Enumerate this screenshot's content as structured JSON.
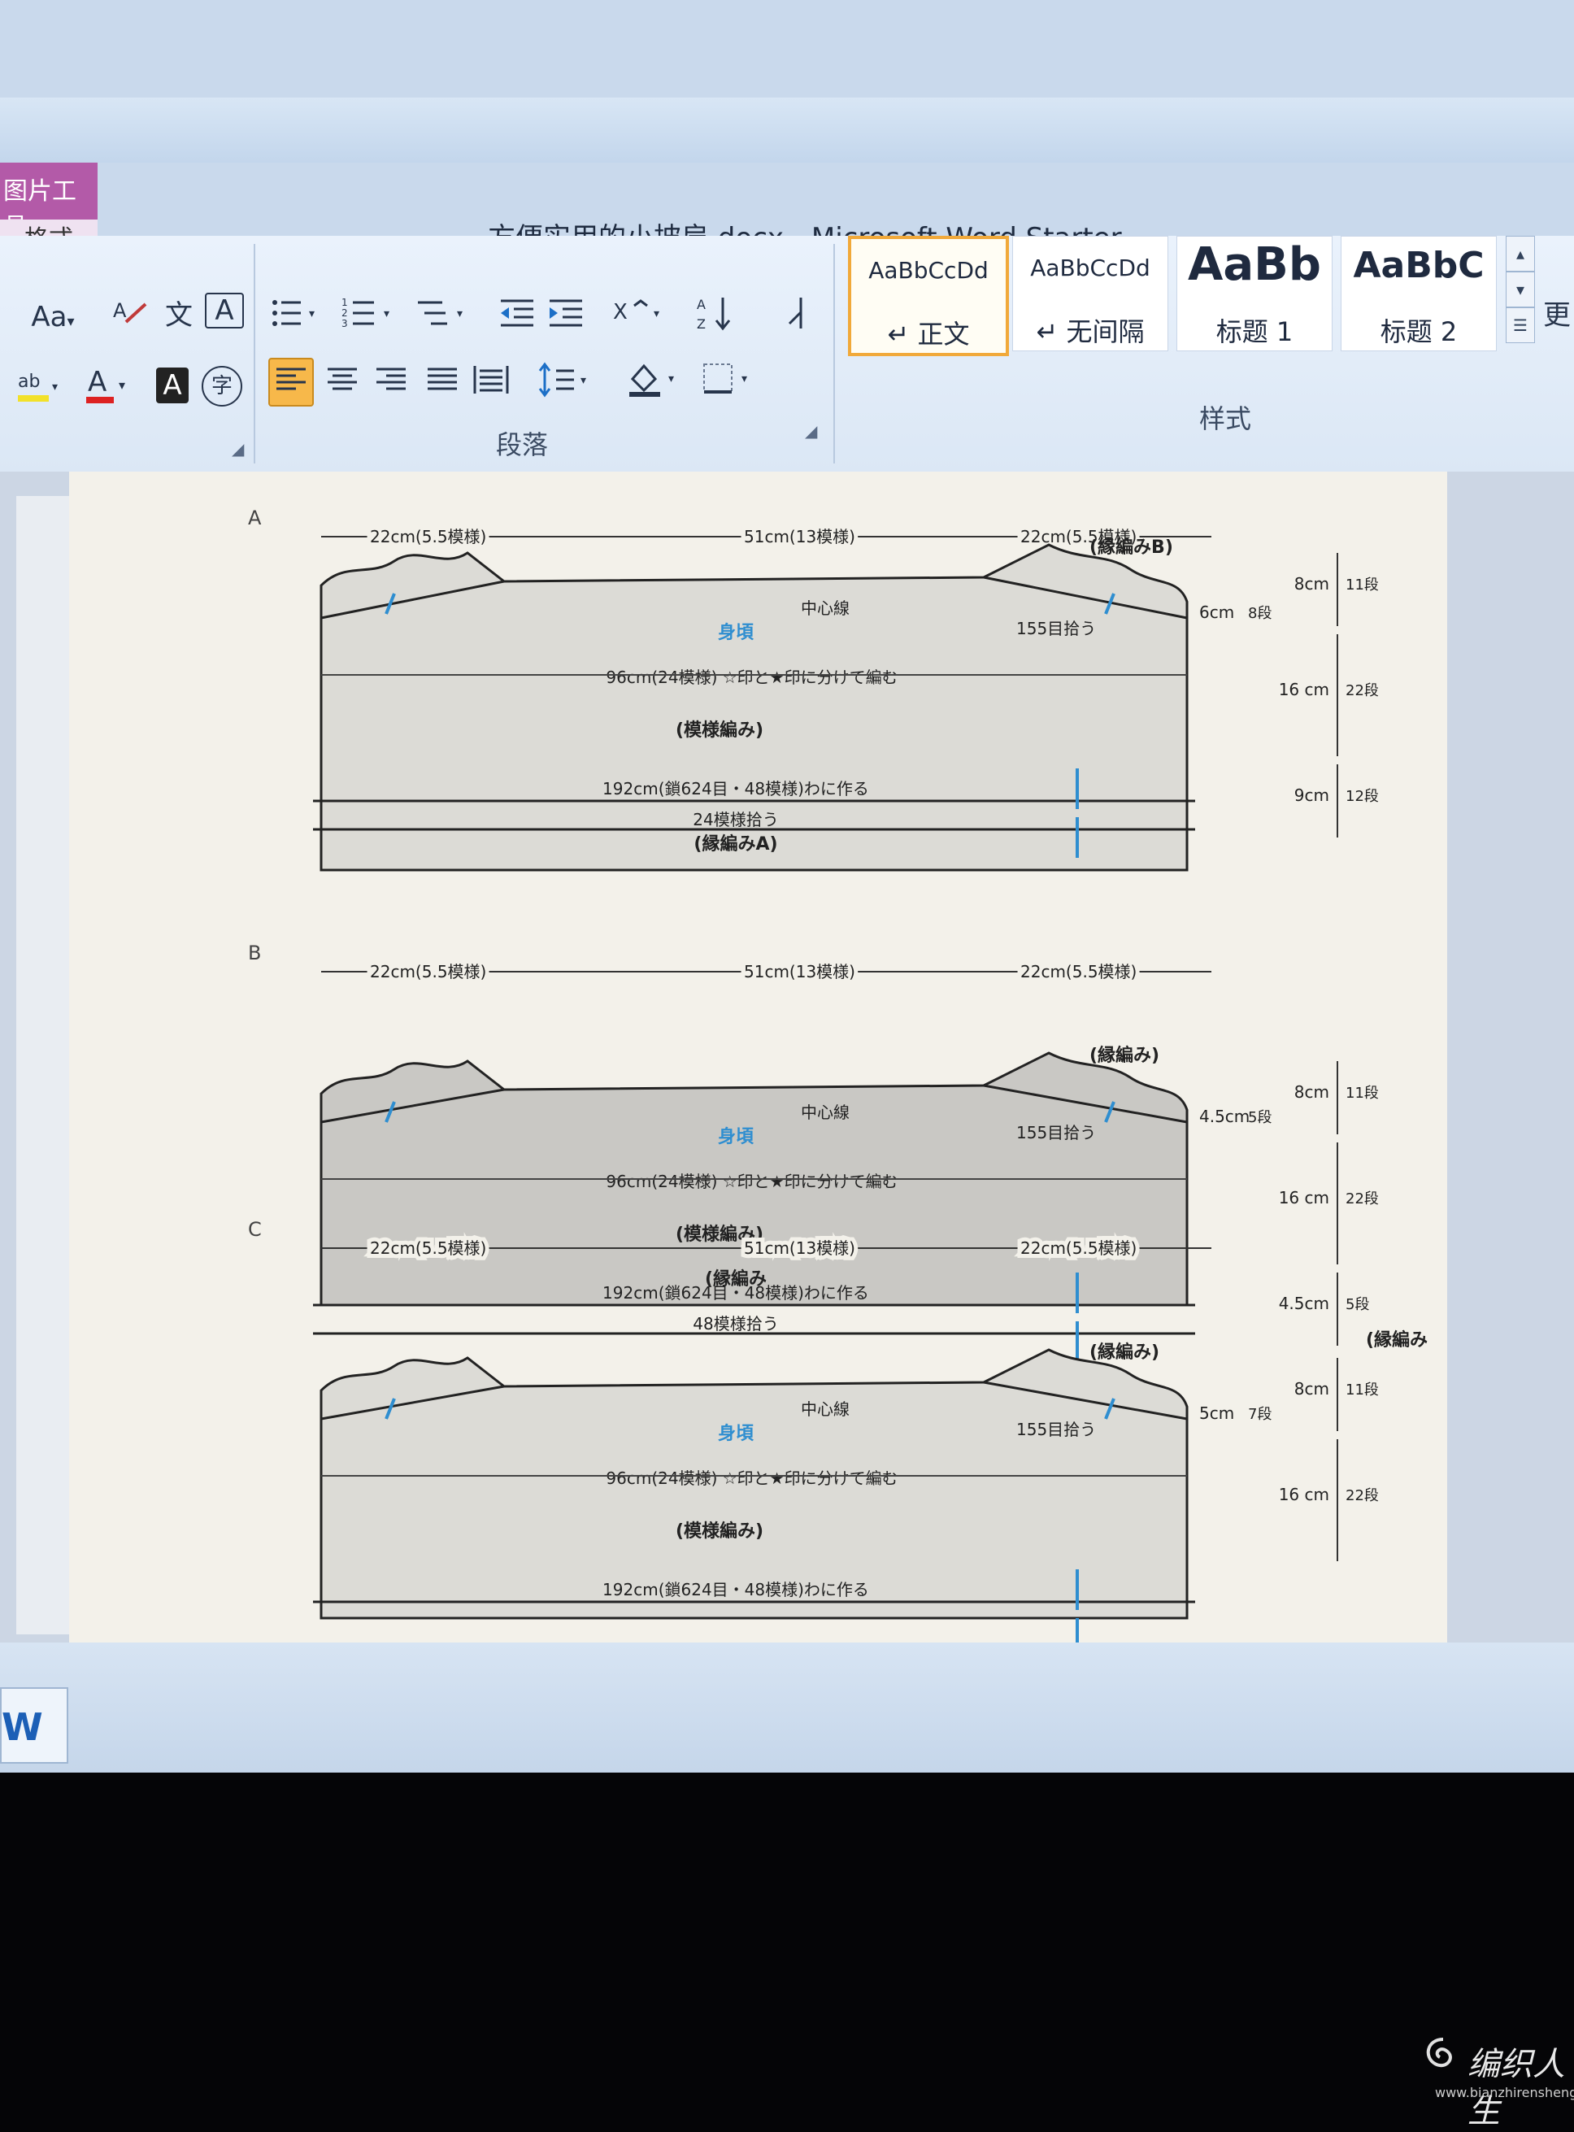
{
  "window": {
    "title": "方便实用的小披肩.docx - Microsoft Word Starter",
    "tool_tab": "图片工具",
    "tool_tab_sub": "格式"
  },
  "ribbon": {
    "font_group": {
      "change_case": "Aa",
      "phonetic": "文",
      "border_char": "A",
      "font_color": "A",
      "char_shading": "A",
      "enclose": "字"
    },
    "paragraph_group": {
      "label": "段落"
    },
    "styles_group": {
      "label": "样式",
      "styles": [
        {
          "sample": "AaBbCcDd",
          "name": "↵ 正文",
          "selected": true
        },
        {
          "sample": "AaBbCcDd",
          "name": "↵ 无间隔",
          "selected": false
        },
        {
          "sample": "AaBb",
          "name": "标题 1",
          "selected": false
        },
        {
          "sample": "AaBbC",
          "name": "标题 2",
          "selected": false
        }
      ],
      "change_styles": "更"
    }
  },
  "document": {
    "diagrams": [
      {
        "label": "A",
        "top_dims": {
          "left": "22cm(5.5模様)",
          "center": "51cm(13模様)",
          "right": "22cm(5.5模様)"
        },
        "edge_label": "(縁編みB)",
        "body": "身頃",
        "center_line": "中心線",
        "pickup": "155目拾う",
        "shoulder": "6cm",
        "shoulder_rows": "8段",
        "body_width": "96cm(24模様) ☆印と★印に分けて編む",
        "pattern": "(模様編み)",
        "chain": "192cm(鎖624目・48模様)わに作る",
        "pick": "24模様拾う",
        "bottom_edge": "(縁編みA)",
        "side": [
          {
            "v": "8cm",
            "rows": "11段"
          },
          {
            "v": "16 cm",
            "rows": "22段"
          },
          {
            "v": "9cm",
            "rows": "12段"
          }
        ]
      },
      {
        "label": "B",
        "top_dims": {
          "left": "22cm(5.5模様)",
          "center": "51cm(13模様)",
          "right": "22cm(5.5模様)"
        },
        "edge_label": "(縁編み)",
        "body": "身頃",
        "center_line": "中心線",
        "pickup": "155目拾う",
        "shoulder": "4.5cm",
        "shoulder_rows": "5段",
        "body_width": "96cm(24模様) ☆印と★印に分けて編む",
        "pattern": "(模様編み)",
        "chain": "192cm(鎖624目・48模様)わに作る",
        "pick": "48模様拾う",
        "bottom_edge": "(縁編み",
        "side": [
          {
            "v": "8cm",
            "rows": "11段"
          },
          {
            "v": "16 cm",
            "rows": "22段"
          },
          {
            "v": "4.5cm",
            "rows": "5段"
          }
        ]
      },
      {
        "label": "C",
        "top_dims": {
          "left": "22cm(5.5模様)",
          "center": "51cm(13模様)",
          "right": "22cm(5.5模様)"
        },
        "edge_label": "(縁編み)",
        "body": "身頃",
        "center_line": "中心線",
        "pickup": "155目拾う",
        "shoulder": "5cm",
        "shoulder_rows": "7段",
        "body_width": "96cm(24模様) ☆印と★印に分けて編む",
        "pattern": "(模様編み)",
        "chain": "192cm(鎖624目・48模様)わに作る",
        "side": [
          {
            "v": "8cm",
            "rows": "11段"
          },
          {
            "v": "16 cm",
            "rows": "22段"
          }
        ]
      }
    ]
  },
  "taskbar": {
    "word_icon": "W"
  },
  "watermark": {
    "site": "编织人生",
    "url": "www.bianzhirensheng.com"
  },
  "colors": {
    "accent_body": "#2f8ed0",
    "selected_style": "#f1a93a",
    "tool_tab": "#b35aa8"
  }
}
